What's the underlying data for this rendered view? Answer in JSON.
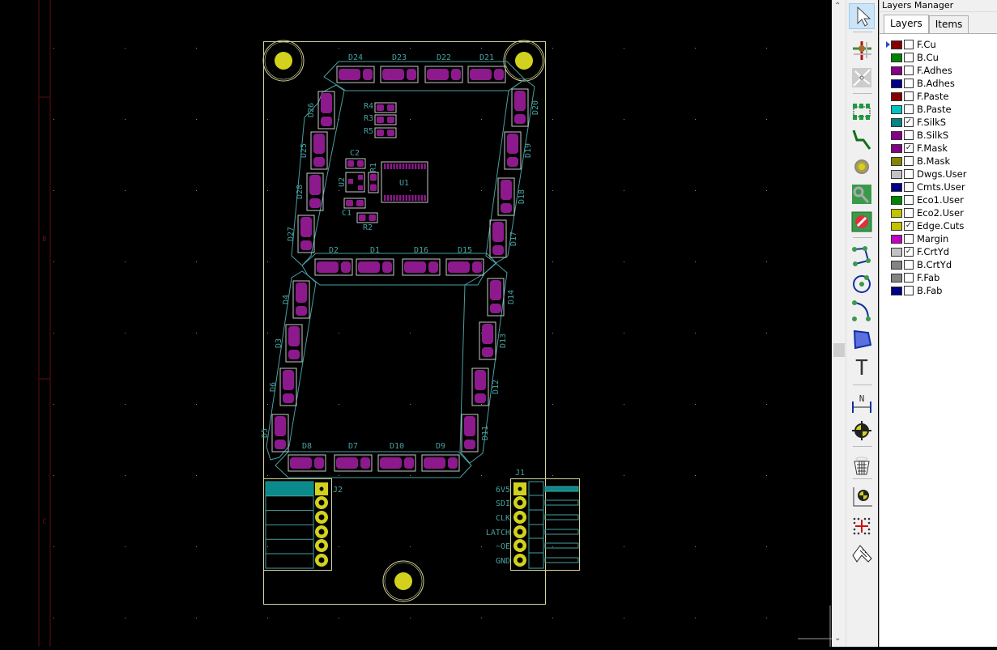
{
  "canvas": {
    "frame_letters": [
      "B",
      "C"
    ],
    "colors": {
      "silk": "#48a0a0",
      "pad": "#8c1a8c",
      "courtyard": "#c8c8c8",
      "edge": "#d4d49a",
      "hole": "#d2d21e",
      "frame": "#5a1010",
      "grid": "#8a8a8a"
    },
    "leds": [
      "D24",
      "D23",
      "D22",
      "D21",
      "D2",
      "D1",
      "D16",
      "D15",
      "D8",
      "D7",
      "D10",
      "D9",
      "D26",
      "D25",
      "D28",
      "D27",
      "D20",
      "D19",
      "D18",
      "D17",
      "D4",
      "D3",
      "D6",
      "D5",
      "D14",
      "D13",
      "D12",
      "D11"
    ],
    "parts": {
      "U1": "U1",
      "U2": "U2",
      "R1": "R1",
      "R2": "R2",
      "R3": "R3",
      "R4": "R4",
      "R5": "R5",
      "C1": "C1",
      "C2": "C2",
      "J1": "J1",
      "J2": "J2"
    },
    "j1_pins": [
      "6V5",
      "SDI",
      "CLK",
      "LATCH",
      "~OE",
      "GND"
    ]
  },
  "toolbar": {
    "icons": [
      "select-arrow-icon",
      "highlight-net-icon",
      "local-ratsnest-icon",
      "add-footprint-icon",
      "route-track-icon",
      "add-via-icon",
      "add-zone-icon",
      "add-keepout-icon",
      "add-graphic-line-icon",
      "add-circle-icon",
      "add-arc-icon",
      "add-polygon-icon",
      "add-text-icon",
      "add-dimension-icon",
      "add-target-icon",
      "delete-icon",
      "place-origin-icon",
      "grid-origin-icon",
      "measure-icon"
    ]
  },
  "layers_manager": {
    "title": "Layers Manager",
    "tabs": [
      "Layers",
      "Items"
    ],
    "active_tab": "Layers",
    "layers": [
      {
        "name": "F.Cu",
        "color": "#840000",
        "checked": false,
        "current": true
      },
      {
        "name": "B.Cu",
        "color": "#008400",
        "checked": false
      },
      {
        "name": "F.Adhes",
        "color": "#840084",
        "checked": false
      },
      {
        "name": "B.Adhes",
        "color": "#000084",
        "checked": false
      },
      {
        "name": "F.Paste",
        "color": "#840000",
        "checked": false
      },
      {
        "name": "B.Paste",
        "color": "#00c2c2",
        "checked": false
      },
      {
        "name": "F.SilkS",
        "color": "#008484",
        "checked": true
      },
      {
        "name": "B.SilkS",
        "color": "#840084",
        "checked": false
      },
      {
        "name": "F.Mask",
        "color": "#840084",
        "checked": true
      },
      {
        "name": "B.Mask",
        "color": "#848400",
        "checked": false
      },
      {
        "name": "Dwgs.User",
        "color": "#c2c2c2",
        "checked": false
      },
      {
        "name": "Cmts.User",
        "color": "#000084",
        "checked": false
      },
      {
        "name": "Eco1.User",
        "color": "#008400",
        "checked": false
      },
      {
        "name": "Eco2.User",
        "color": "#c2c200",
        "checked": false
      },
      {
        "name": "Edge.Cuts",
        "color": "#c2c200",
        "checked": true
      },
      {
        "name": "Margin",
        "color": "#c200c2",
        "checked": false
      },
      {
        "name": "F.CrtYd",
        "color": "#c2c2c2",
        "checked": true
      },
      {
        "name": "B.CrtYd",
        "color": "#848484",
        "checked": false
      },
      {
        "name": "F.Fab",
        "color": "#848484",
        "checked": false
      },
      {
        "name": "B.Fab",
        "color": "#000084",
        "checked": false
      }
    ]
  }
}
